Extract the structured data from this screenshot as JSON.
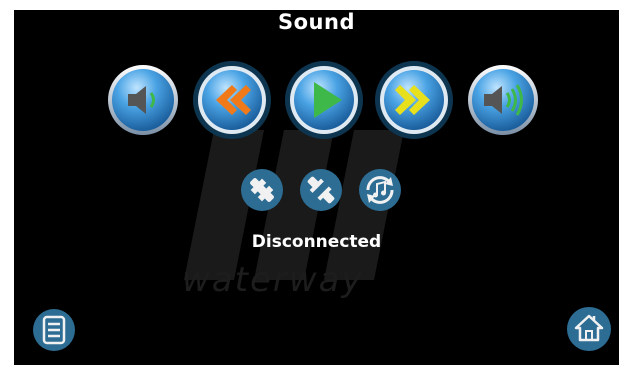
{
  "screen": {
    "title": "Sound",
    "status": "Disconnected",
    "watermark": "waterway"
  },
  "controls": [
    {
      "name": "volume-down",
      "icon": "speaker-low-icon"
    },
    {
      "name": "rewind",
      "icon": "rewind-icon"
    },
    {
      "name": "play",
      "icon": "play-icon"
    },
    {
      "name": "fast-forward",
      "icon": "fast-forward-icon"
    },
    {
      "name": "volume-up",
      "icon": "speaker-high-icon"
    }
  ],
  "connection_icons": [
    "plug-connected-icon",
    "plug-disconnected-icon",
    "music-sync-icon"
  ],
  "nav": {
    "menu_icon": "menu-icon",
    "home_icon": "home-icon"
  },
  "colors": {
    "background": "#000000",
    "button_blue": "#3a8fd0",
    "arrow_orange": "#f07a1a",
    "arrow_green": "#3fb84a",
    "arrow_yellow": "#e8e01c",
    "text": "#ffffff"
  }
}
